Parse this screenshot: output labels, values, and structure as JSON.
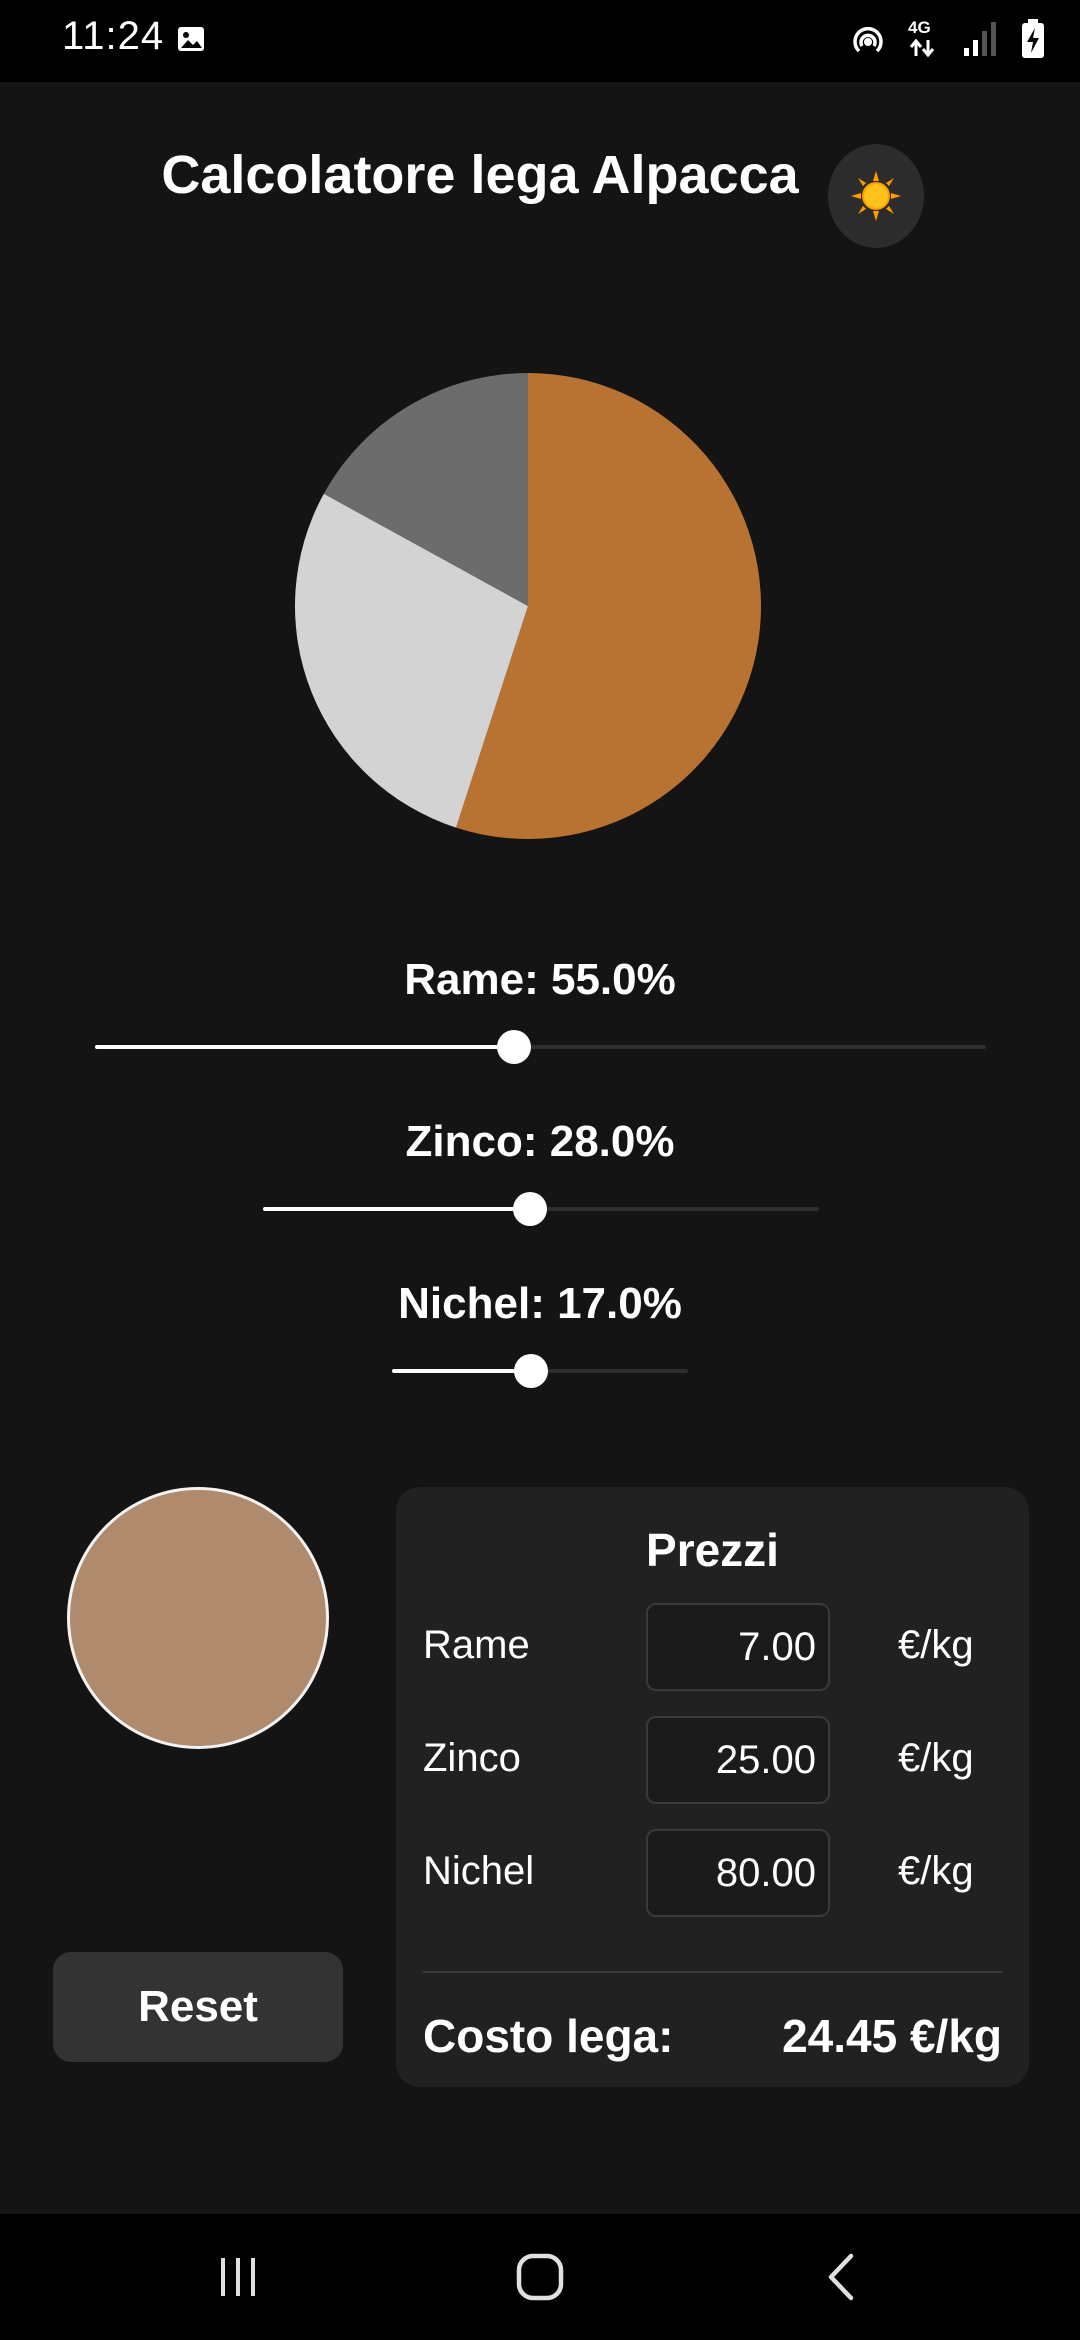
{
  "status_bar": {
    "time": "11:24",
    "icons": [
      "gallery-icon",
      "hotspot-icon",
      "network-4g-icon",
      "signal-icon",
      "battery-charging-icon"
    ],
    "network_label": "4G"
  },
  "header": {
    "title": "Calcolatore lega Alpacca",
    "theme_toggle_icon": "sun-icon"
  },
  "chart_data": {
    "type": "pie",
    "slices": [
      {
        "label": "Rame",
        "value": 55.0,
        "color": "#b87333"
      },
      {
        "label": "Zinco",
        "value": 28.0,
        "color": "#d3d3d3"
      },
      {
        "label": "Nichel",
        "value": 17.0,
        "color": "#6c6c6c"
      }
    ],
    "start_angle_deg": 0,
    "direction": "clockwise"
  },
  "sliders": [
    {
      "name": "rame",
      "label": "Rame: 55.0%",
      "value": 55.0,
      "fill_fraction": 0.47
    },
    {
      "name": "zinco",
      "label": "Zinco: 28.0%",
      "value": 28.0,
      "fill_fraction": 0.48
    },
    {
      "name": "nichel",
      "label": "Nichel: 17.0%",
      "value": 17.0,
      "fill_fraction": 0.47
    }
  ],
  "alloy_preview": {
    "color": "#b08a6c"
  },
  "prices": {
    "title": "Prezzi",
    "rows": [
      {
        "metal": "Rame",
        "value": "7.00",
        "unit": "€/kg"
      },
      {
        "metal": "Zinco",
        "value": "25.00",
        "unit": "€/kg"
      },
      {
        "metal": "Nichel",
        "value": "80.00",
        "unit": "€/kg"
      }
    ],
    "cost_label": "Costo lega:",
    "cost_value": "24.45 €/kg"
  },
  "actions": {
    "reset_label": "Reset"
  },
  "nav_bar": {
    "icons": [
      "recent-apps-icon",
      "home-icon",
      "back-icon"
    ]
  }
}
